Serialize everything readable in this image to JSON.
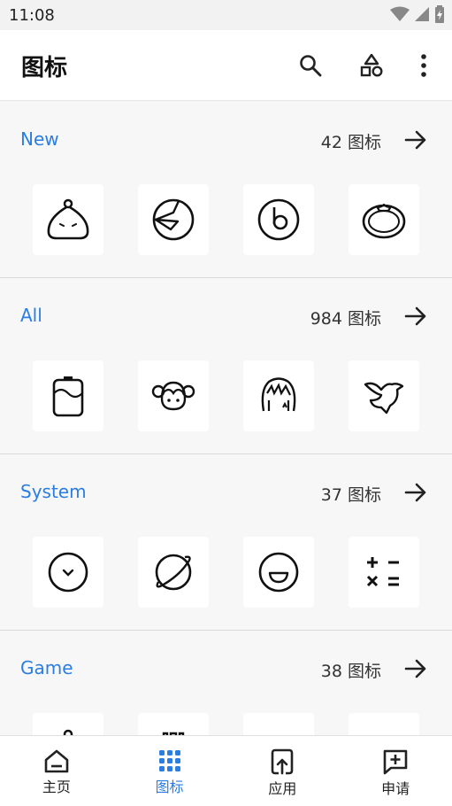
{
  "status_bar": {
    "time": "11:08"
  },
  "app_bar": {
    "title": "图标"
  },
  "sections": [
    {
      "title": "New",
      "count": "42 图标",
      "icons": [
        "drop-face-icon",
        "pie-clock-icon",
        "beats-icon",
        "tomato-icon"
      ]
    },
    {
      "title": "All",
      "count": "984 图标",
      "icons": [
        "battery-wave-icon",
        "twin-tail-girl-icon",
        "messy-hair-girl-icon",
        "dove-icon"
      ]
    },
    {
      "title": "System",
      "count": "37 图标",
      "icons": [
        "clock-icon",
        "planet-icon",
        "smile-icon",
        "calculator-icon"
      ]
    },
    {
      "title": "Game",
      "count": "38 图标",
      "icons": [
        "game-icon-1",
        "game-icon-2",
        "game-icon-3",
        "game-icon-4"
      ]
    }
  ],
  "bottom_nav": {
    "items": [
      {
        "label": "主页",
        "icon": "home-icon"
      },
      {
        "label": "图标",
        "icon": "grid-icon"
      },
      {
        "label": "应用",
        "icon": "apply-icon"
      },
      {
        "label": "申请",
        "icon": "request-icon"
      }
    ],
    "active_index": 1
  },
  "colors": {
    "accent": "#2b7de1",
    "background": "#f7f7f7"
  }
}
